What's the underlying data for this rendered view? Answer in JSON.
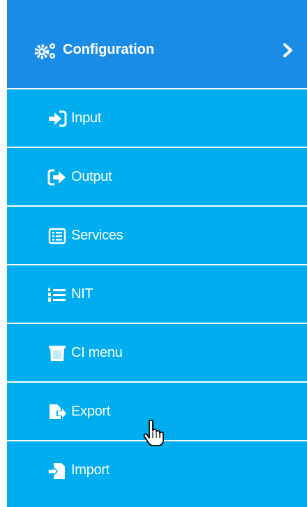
{
  "header": {
    "title": "Configuration",
    "icon": "cogs-icon",
    "chevron": "chevron-right-icon"
  },
  "items": [
    {
      "label": "Input",
      "icon": "sign-in-icon"
    },
    {
      "label": "Output",
      "icon": "sign-out-icon"
    },
    {
      "label": "Services",
      "icon": "list-alt-icon"
    },
    {
      "label": "NIT",
      "icon": "list-ol-icon"
    },
    {
      "label": "CI menu",
      "icon": "trash-box-icon"
    },
    {
      "label": "Export",
      "icon": "file-export-icon"
    },
    {
      "label": "Import",
      "icon": "file-import-icon"
    }
  ],
  "colors": {
    "header_bg": "#1a8ce6",
    "item_bg": "#00aeef",
    "text": "#ffffff"
  }
}
